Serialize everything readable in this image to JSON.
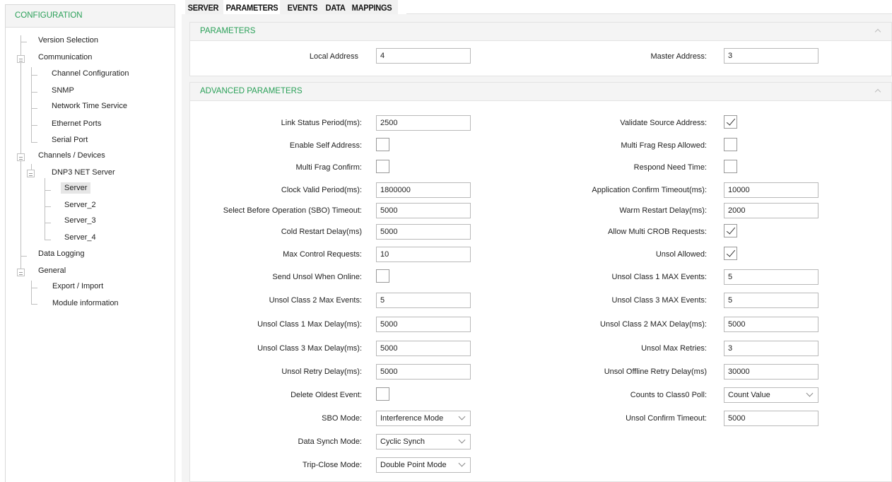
{
  "sidebar": {
    "header": "CONFIGURATION",
    "tree": [
      {
        "label": "Version Selection"
      },
      {
        "label": "Communication"
      },
      {
        "label": "Channel Configuration"
      },
      {
        "label": "SNMP"
      },
      {
        "label": "Network Time Service"
      },
      {
        "label": "Ethernet Ports"
      },
      {
        "label": "Serial Port"
      },
      {
        "label": "Channels / Devices"
      },
      {
        "label": "DNP3 NET Server"
      },
      {
        "label": "Server",
        "selected": true
      },
      {
        "label": "Server_2"
      },
      {
        "label": "Server_3"
      },
      {
        "label": "Server_4"
      },
      {
        "label": "Data Logging"
      },
      {
        "label": "General"
      },
      {
        "label": "Export / Import"
      },
      {
        "label": "Module information"
      }
    ]
  },
  "tabs": [
    {
      "label": "SERVER"
    },
    {
      "label": "PARAMETERS",
      "active": true
    },
    {
      "label": "EVENTS"
    },
    {
      "label": "DATA"
    },
    {
      "label": "MAPPINGS"
    }
  ],
  "parameters": {
    "title": "PARAMETERS",
    "local_address": {
      "label": "Local Address",
      "value": "4"
    },
    "master_address": {
      "label": "Master Address:",
      "value": "3"
    }
  },
  "advanced": {
    "title": "ADVANCED PARAMETERS",
    "left": [
      {
        "label": "Link Status Period(ms):",
        "type": "text",
        "value": "2500"
      },
      {
        "label": "Enable Self Address:",
        "type": "checkbox",
        "checked": false
      },
      {
        "label": "Multi Frag Confirm:",
        "type": "checkbox",
        "checked": false
      },
      {
        "label": "Clock Valid Period(ms):",
        "type": "text",
        "value": "1800000"
      },
      {
        "label": "Select Before Operation (SBO) Timeout:",
        "type": "text",
        "value": "5000"
      },
      {
        "label": "Cold Restart Delay(ms)",
        "type": "text",
        "value": "5000"
      },
      {
        "label": "Max Control Requests:",
        "type": "text",
        "value": "10"
      },
      {
        "label": "Send Unsol When Online:",
        "type": "checkbox",
        "checked": false
      },
      {
        "label": "Unsol Class 2 Max Events:",
        "type": "text",
        "value": "5"
      },
      {
        "label": "Unsol Class 1 Max Delay(ms):",
        "type": "text",
        "value": "5000"
      },
      {
        "label": "Unsol Class 3 Max Delay(ms):",
        "type": "text",
        "value": "5000"
      },
      {
        "label": "Unsol Retry Delay(ms):",
        "type": "text",
        "value": "5000"
      },
      {
        "label": "Delete Oldest Event:",
        "type": "checkbox",
        "checked": false
      },
      {
        "label": "SBO Mode:",
        "type": "select",
        "value": "Interference Mode"
      },
      {
        "label": "Data Synch Mode:",
        "type": "select",
        "value": "Cyclic  Synch"
      },
      {
        "label": "Trip-Close Mode:",
        "type": "select",
        "value": "Double Point Mode"
      }
    ],
    "right": [
      {
        "label": "Validate Source Address:",
        "type": "checkbox",
        "checked": true
      },
      {
        "label": "Multi Frag Resp Allowed:",
        "type": "checkbox",
        "checked": false
      },
      {
        "label": "Respond Need Time:",
        "type": "checkbox",
        "checked": false
      },
      {
        "label": "Application Confirm Timeout(ms):",
        "type": "text",
        "value": "10000"
      },
      {
        "label": "Warm Restart Delay(ms):",
        "type": "text",
        "value": "2000"
      },
      {
        "label": "Allow Multi CROB Requests:",
        "type": "checkbox",
        "checked": true
      },
      {
        "label": "Unsol Allowed:",
        "type": "checkbox",
        "checked": true
      },
      {
        "label": "Unsol Class 1  MAX Events:",
        "type": "text",
        "value": "5"
      },
      {
        "label": "Unsol Class 3  MAX Events:",
        "type": "text",
        "value": "5"
      },
      {
        "label": "Unsol Class 2  MAX Delay(ms):",
        "type": "text",
        "value": "5000"
      },
      {
        "label": "Unsol Max Retries:",
        "type": "text",
        "value": "3"
      },
      {
        "label": "Unsol Offline Retry Delay(ms)",
        "type": "text",
        "value": "30000"
      },
      {
        "label": "Counts to Class0 Poll:",
        "type": "select",
        "value": "Count Value"
      },
      {
        "label": "Unsol  Confirm Timeout:",
        "type": "text",
        "value": "5000"
      }
    ]
  }
}
